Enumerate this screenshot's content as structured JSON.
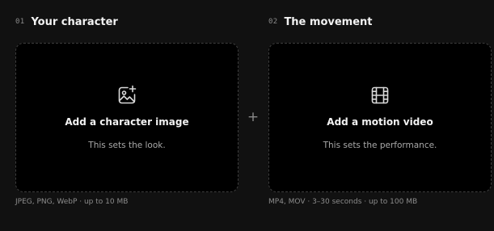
{
  "steps": [
    {
      "number": "01",
      "title": "Your character",
      "dropzone": {
        "icon": "image-add-icon",
        "title": "Add a character image",
        "subtitle": "This sets the look."
      },
      "hint": "JPEG, PNG, WebP · up to 10 MB"
    },
    {
      "number": "02",
      "title": "The movement",
      "dropzone": {
        "icon": "film-icon",
        "title": "Add a motion video",
        "subtitle": "This sets the performance."
      },
      "hint": "MP4, MOV · 3–30 seconds · up to 100 MB"
    }
  ],
  "separator": "+",
  "colors": {
    "background": "#111111",
    "dropzone": "#000000",
    "dropzone_border": "#3d3d3d",
    "text_primary": "#f2f2f2",
    "text_muted": "#8c8c8c"
  }
}
